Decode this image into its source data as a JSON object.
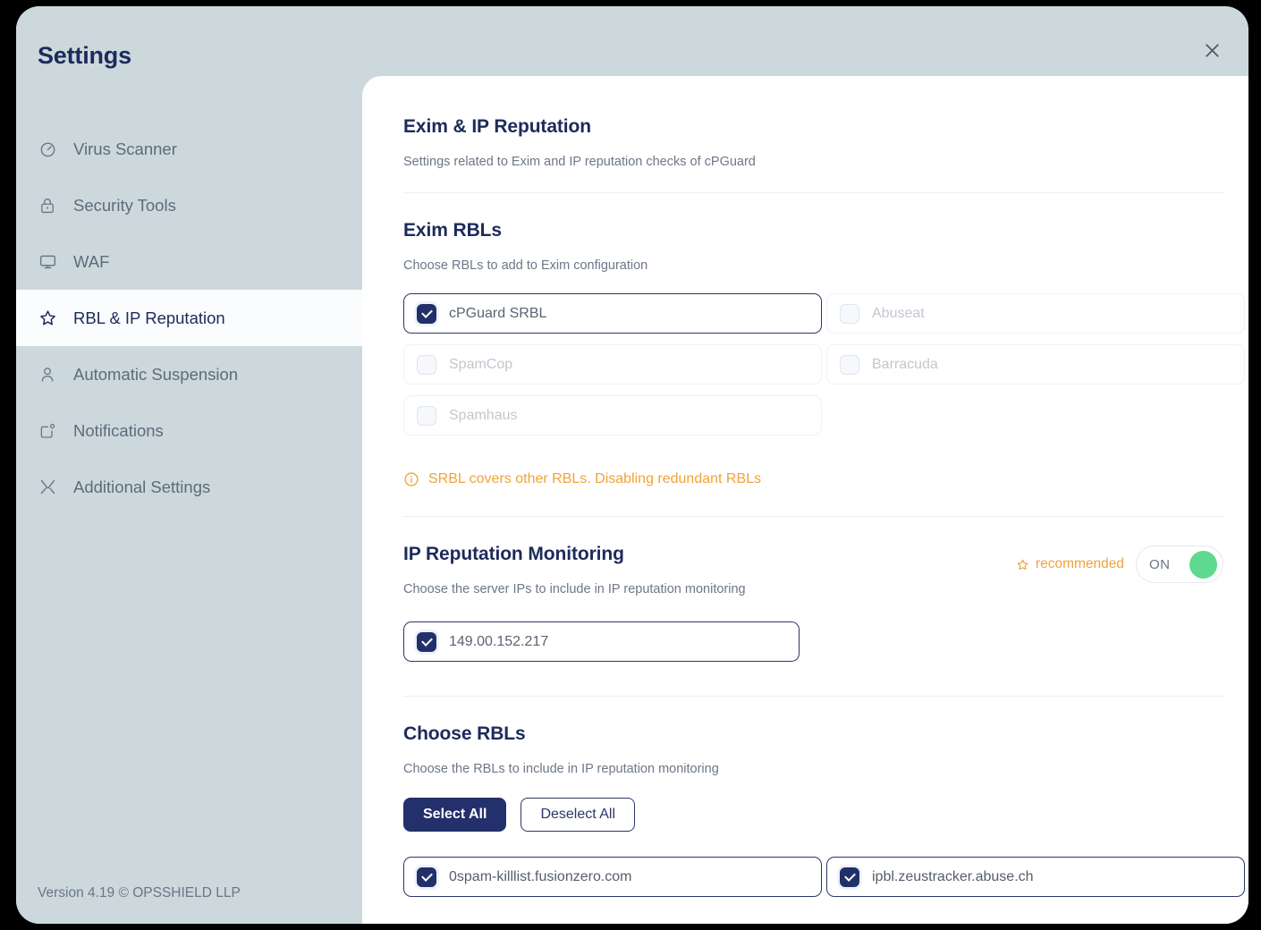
{
  "modal": {
    "title": "Settings",
    "close_icon": "close-icon",
    "version_text": "Version 4.19 © OPSSHIELD LLP"
  },
  "theme": {
    "sidebar_bg": "#cdd8dd",
    "panel_bg": "#ffffff",
    "accent_navy": "#23306b",
    "accent_orange": "#f0a33c",
    "toggle_green": "#5ed98f",
    "muted_text": "#6d7787"
  },
  "sidebar": {
    "items": [
      {
        "label": "Virus Scanner",
        "icon": "stopwatch-icon",
        "active": false
      },
      {
        "label": "Security Tools",
        "icon": "lock-icon",
        "active": false
      },
      {
        "label": "WAF",
        "icon": "monitor-icon",
        "active": false
      },
      {
        "label": "RBL & IP Reputation",
        "icon": "star-icon",
        "active": true
      },
      {
        "label": "Automatic Suspension",
        "icon": "user-icon",
        "active": false
      },
      {
        "label": "Notifications",
        "icon": "notification-icon",
        "active": false
      },
      {
        "label": "Additional Settings",
        "icon": "tools-icon",
        "active": false
      }
    ]
  },
  "main": {
    "header": {
      "title": "Exim & IP Reputation",
      "subtitle": "Settings related to Exim and IP reputation checks of cPGuard"
    },
    "exim_rbls": {
      "title": "Exim RBLs",
      "subtitle": "Choose RBLs to add to Exim configuration",
      "options": [
        {
          "label": "cPGuard SRBL",
          "checked": true,
          "column": "left"
        },
        {
          "label": "Abuseat",
          "checked": false,
          "column": "right"
        },
        {
          "label": "SpamCop",
          "checked": false,
          "column": "left"
        },
        {
          "label": "Barracuda",
          "checked": false,
          "column": "right"
        },
        {
          "label": "Spamhaus",
          "checked": false,
          "column": "left"
        }
      ],
      "warning": "SRBL covers other RBLs. Disabling redundant RBLs",
      "warning_icon": "info-circle-icon"
    },
    "ip_reputation": {
      "title": "IP Reputation Monitoring",
      "subtitle": "Choose the server IPs to include in IP reputation monitoring",
      "recommended_label": "recommended",
      "recommended_icon": "star-icon",
      "toggle_state": "ON",
      "ips": [
        {
          "label": "149.00.152.217",
          "checked": true
        }
      ]
    },
    "choose_rbls": {
      "title": "Choose RBLs",
      "subtitle": "Choose the RBLs to include in IP reputation monitoring",
      "select_all_label": "Select All",
      "deselect_all_label": "Deselect All",
      "options": [
        {
          "label": "0spam-killlist.fusionzero.com",
          "checked": true,
          "column": "left"
        },
        {
          "label": "ipbl.zeustracker.abuse.ch",
          "checked": true,
          "column": "right"
        }
      ]
    }
  }
}
